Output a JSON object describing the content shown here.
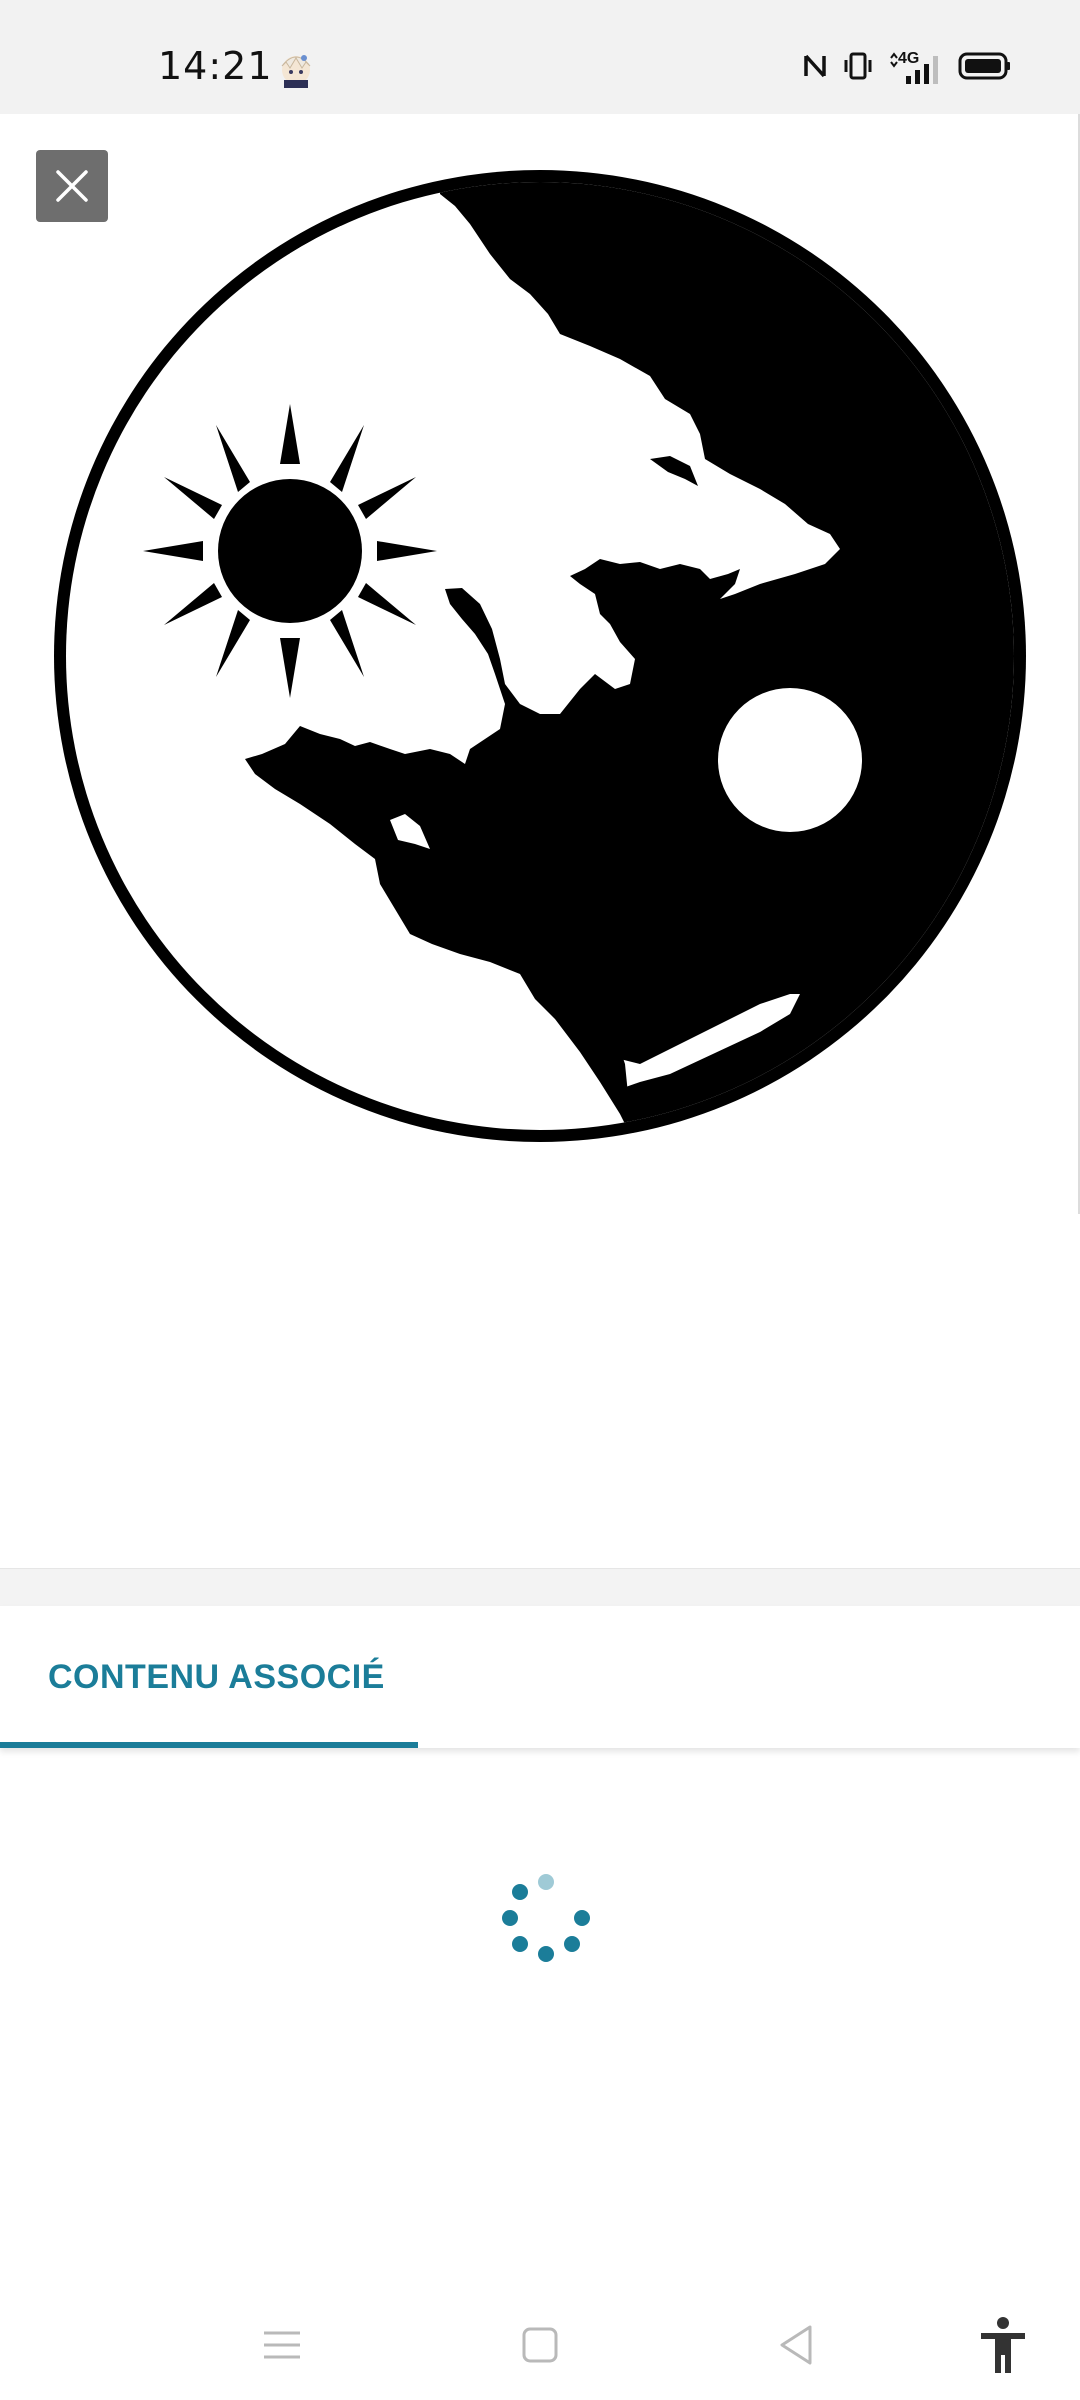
{
  "status_bar": {
    "time": "14:21",
    "network_label": "4G",
    "icons": [
      "avatar-notification-icon",
      "nfc-icon",
      "vibrate-icon",
      "signal-4g-icon",
      "battery-icon"
    ]
  },
  "viewer": {
    "close_icon": "close-icon",
    "image_description_icon": "yin-yang-wolves-sun-moon"
  },
  "tabs": [
    {
      "label": "CONTENU ASSOCIÉ",
      "active": true
    }
  ],
  "loading": {
    "icon": "loading-spinner-icon"
  },
  "nav_bar": {
    "icons": [
      "menu-icon",
      "home-icon",
      "back-icon",
      "accessibility-icon"
    ]
  },
  "colors": {
    "accent": "#1b7d99",
    "status_bar_bg": "#f2f2f2",
    "close_button_bg": "#6e6e6e",
    "spinner_light": "#9fcad6"
  }
}
